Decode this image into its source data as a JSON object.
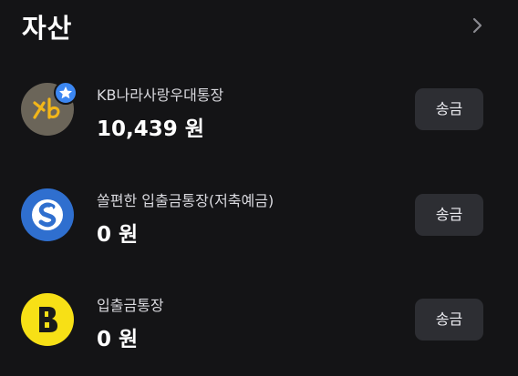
{
  "section": {
    "title": "자산"
  },
  "accounts": [
    {
      "name": "KB나라사랑우대통장",
      "balance": "10,439 원",
      "send_label": "송금",
      "icon": "kb-bank-logo",
      "badge_icon": "star-badge-icon"
    },
    {
      "name": "쏠편한 입출금통장(저축예금)",
      "balance": "0 원",
      "send_label": "송금",
      "icon": "shinhan-bank-logo"
    },
    {
      "name": "입출금통장",
      "balance": "0 원",
      "send_label": "송금",
      "icon": "kakao-bank-logo"
    }
  ],
  "colors": {
    "background": "#141416",
    "button_bg": "#2d2e33",
    "kb_logo_bg": "#6b6559",
    "kb_logo_mark": "#f2b619",
    "badge": "#3c87f2",
    "shinhan_logo_bg": "#2f6fcf",
    "kakao_logo_bg": "#f7e016"
  }
}
